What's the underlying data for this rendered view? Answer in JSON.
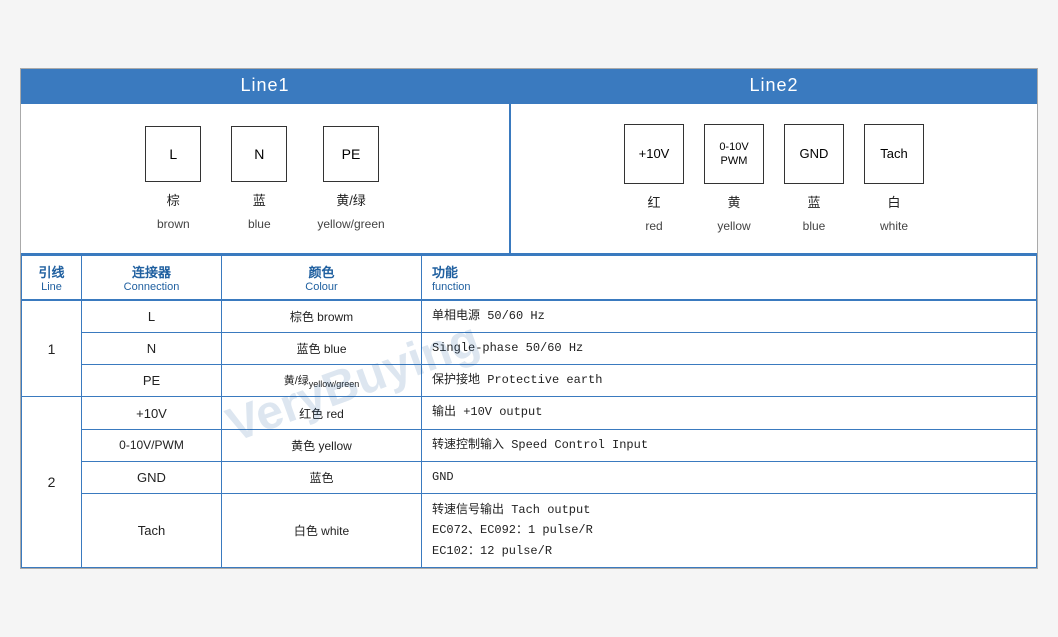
{
  "header": {
    "line1_label": "Line1",
    "line2_label": "Line2"
  },
  "line1_connectors": [
    {
      "id": "L",
      "cn": "棕",
      "en": "brown"
    },
    {
      "id": "N",
      "cn": "蓝",
      "en": "blue"
    },
    {
      "id": "PE",
      "cn": "黄/绿",
      "en": "yellow/green"
    }
  ],
  "line2_connectors": [
    {
      "id": "+10V",
      "cn": "红",
      "en": "red"
    },
    {
      "id": "0-10V\nPWM",
      "cn": "黄",
      "en": "yellow"
    },
    {
      "id": "GND",
      "cn": "蓝",
      "en": "blue"
    },
    {
      "id": "Tach",
      "cn": "白",
      "en": "white"
    }
  ],
  "table_headers": {
    "line_cn": "引线",
    "line_en": "Line",
    "conn_cn": "连接器",
    "conn_en": "Connection",
    "colour_cn": "颜色",
    "colour_en": "Colour",
    "func_cn": "功能",
    "func_en": "function"
  },
  "table_rows": [
    {
      "line": "1",
      "rowspan_line": 3,
      "entries": [
        {
          "conn": "L",
          "colour_cn": "棕色",
          "colour_en": "browm",
          "func": "单相电源 50/60 Hz"
        },
        {
          "conn": "N",
          "colour_cn": "蓝色",
          "colour_en": "blue",
          "func": "Single-phase 50/60 Hz"
        },
        {
          "conn": "PE",
          "colour_cn": "黄/绿",
          "colour_en": "yellow/green",
          "func": "保护接地 Protective earth"
        }
      ]
    },
    {
      "line": "2",
      "rowspan_line": 4,
      "entries": [
        {
          "conn": "+10V",
          "colour_cn": "红色",
          "colour_en": "red",
          "func": "输出 +10V output"
        },
        {
          "conn": "0-10V/PWM",
          "colour_cn": "黄色",
          "colour_en": "yellow",
          "func": "转速控制输入 Speed Control Input"
        },
        {
          "conn": "GND",
          "colour_cn": "蓝色",
          "colour_en": "",
          "func": "GND"
        },
        {
          "conn": "Tach",
          "colour_cn": "白色",
          "colour_en": "white",
          "func": "转速信号输出 Tach output\nEC072、EC092：1 pulse/R\nEC102：12 pulse/R"
        }
      ]
    }
  ],
  "watermark_text": "VeryBuying"
}
